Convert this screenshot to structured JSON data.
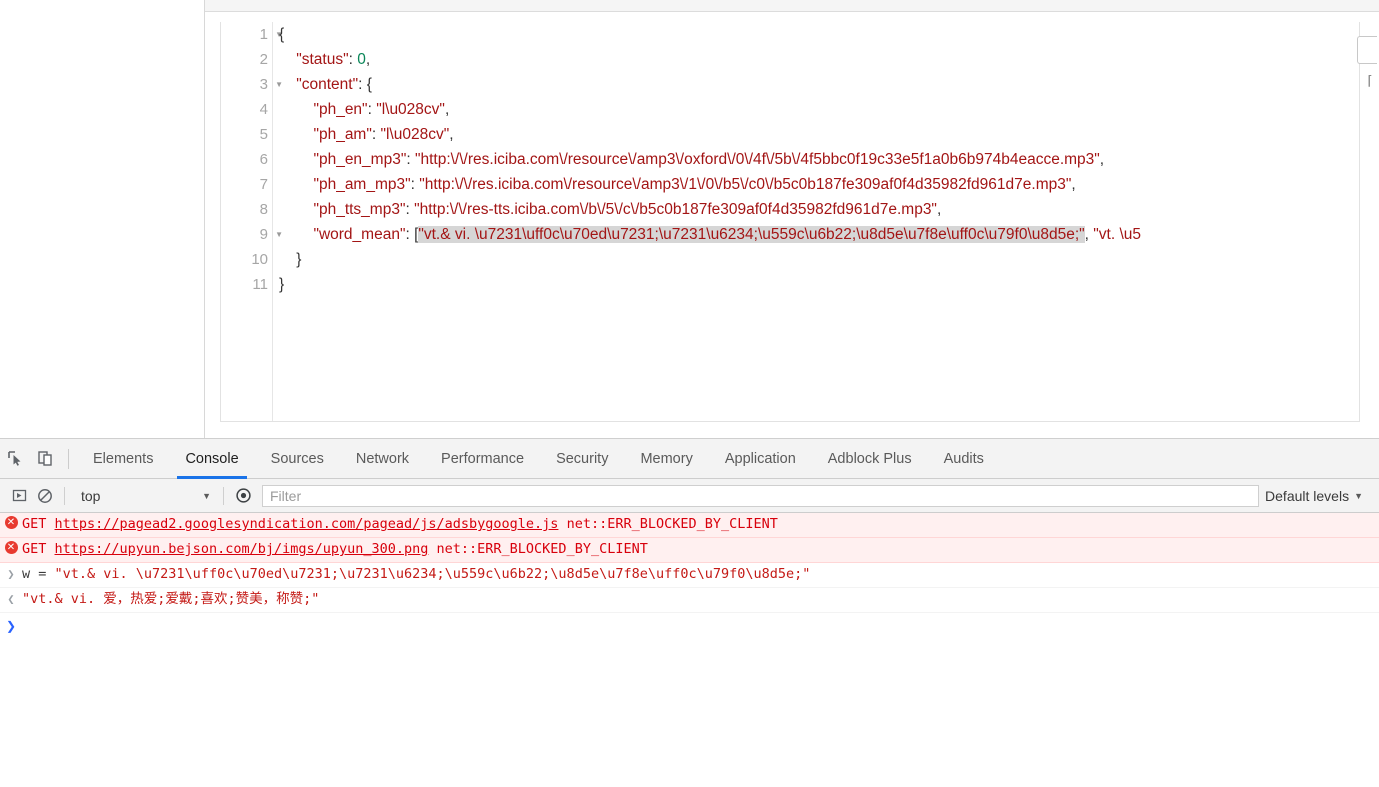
{
  "json_viewer": {
    "line_numbers": [
      "1",
      "2",
      "3",
      "4",
      "5",
      "6",
      "7",
      "8",
      "9",
      "10",
      "11"
    ],
    "fold_lines": [
      1,
      3,
      9
    ],
    "lines": [
      {
        "indent": 0,
        "segments": [
          {
            "t": "{",
            "c": "p"
          }
        ]
      },
      {
        "indent": 1,
        "segments": [
          {
            "t": "\"status\"",
            "c": "k"
          },
          {
            "t": ": ",
            "c": "p"
          },
          {
            "t": "0",
            "c": "n"
          },
          {
            "t": ",",
            "c": "p"
          }
        ]
      },
      {
        "indent": 1,
        "segments": [
          {
            "t": "\"content\"",
            "c": "k"
          },
          {
            "t": ": {",
            "c": "p"
          }
        ]
      },
      {
        "indent": 2,
        "segments": [
          {
            "t": "\"ph_en\"",
            "c": "k"
          },
          {
            "t": ": ",
            "c": "p"
          },
          {
            "t": "\"l\\u028cv\"",
            "c": "k"
          },
          {
            "t": ",",
            "c": "p"
          }
        ]
      },
      {
        "indent": 2,
        "segments": [
          {
            "t": "\"ph_am\"",
            "c": "k"
          },
          {
            "t": ": ",
            "c": "p"
          },
          {
            "t": "\"l\\u028cv\"",
            "c": "k"
          },
          {
            "t": ",",
            "c": "p"
          }
        ]
      },
      {
        "indent": 2,
        "segments": [
          {
            "t": "\"ph_en_mp3\"",
            "c": "k"
          },
          {
            "t": ": ",
            "c": "p"
          },
          {
            "t": "\"http:\\/\\/res.iciba.com\\/resource\\/amp3\\/oxford\\/0\\/4f\\/5b\\/4f5bbc0f19c33e5f1a0b6b974b4eacce.mp3\"",
            "c": "k"
          },
          {
            "t": ",",
            "c": "p"
          }
        ]
      },
      {
        "indent": 2,
        "segments": [
          {
            "t": "\"ph_am_mp3\"",
            "c": "k"
          },
          {
            "t": ": ",
            "c": "p"
          },
          {
            "t": "\"http:\\/\\/res.iciba.com\\/resource\\/amp3\\/1\\/0\\/b5\\/c0\\/b5c0b187fe309af0f4d35982fd961d7e.mp3\"",
            "c": "k"
          },
          {
            "t": ",",
            "c": "p"
          }
        ]
      },
      {
        "indent": 2,
        "segments": [
          {
            "t": "\"ph_tts_mp3\"",
            "c": "k"
          },
          {
            "t": ": ",
            "c": "p"
          },
          {
            "t": "\"http:\\/\\/res-tts.iciba.com\\/b\\/5\\/c\\/b5c0b187fe309af0f4d35982fd961d7e.mp3\"",
            "c": "k"
          },
          {
            "t": ",",
            "c": "p"
          }
        ]
      },
      {
        "indent": 2,
        "segments": [
          {
            "t": "\"word_mean\"",
            "c": "k"
          },
          {
            "t": ": [",
            "c": "p"
          },
          {
            "t": "\"vt.& vi. \\u7231\\uff0c\\u70ed\\u7231;\\u7231\\u6234;\\u559c\\u6b22;\\u8d5e\\u7f8e\\uff0c\\u79f0\\u8d5e;\"",
            "c": "k sel"
          },
          {
            "t": ", ",
            "c": "p"
          },
          {
            "t": "\"vt. \\u5",
            "c": "k"
          }
        ]
      },
      {
        "indent": 1,
        "segments": [
          {
            "t": "}",
            "c": "p"
          }
        ]
      },
      {
        "indent": 0,
        "segments": [
          {
            "t": "}",
            "c": "p"
          }
        ]
      }
    ]
  },
  "devtools": {
    "icons": {
      "inspect": "inspect-element-icon",
      "device": "device-toolbar-icon",
      "execute": "execution-context-icon",
      "clear": "clear-console-icon",
      "eye": "console-sidebar-eye-icon"
    },
    "tabs": [
      {
        "label": "Elements",
        "active": false
      },
      {
        "label": "Console",
        "active": true
      },
      {
        "label": "Sources",
        "active": false
      },
      {
        "label": "Network",
        "active": false
      },
      {
        "label": "Performance",
        "active": false
      },
      {
        "label": "Security",
        "active": false
      },
      {
        "label": "Memory",
        "active": false
      },
      {
        "label": "Application",
        "active": false
      },
      {
        "label": "Adblock Plus",
        "active": false
      },
      {
        "label": "Audits",
        "active": false
      }
    ],
    "filterbar": {
      "context": "top",
      "filter_placeholder": "Filter",
      "filter_value": "",
      "levels": "Default levels"
    },
    "console_rows": [
      {
        "kind": "error",
        "method": "GET",
        "url": "https://pagead2.googlesyndication.com/pagead/js/adsbygoogle.js",
        "neterr": "net::ERR_BLOCKED_BY_CLIENT"
      },
      {
        "kind": "error",
        "method": "GET",
        "url": "https://upyun.bejson.com/bj/imgs/upyun_300.png",
        "neterr": "net::ERR_BLOCKED_BY_CLIENT"
      },
      {
        "kind": "input",
        "expr": "w = ",
        "value": "\"vt.& vi. \\u7231\\uff0c\\u70ed\\u7231;\\u7231\\u6234;\\u559c\\u6b22;\\u8d5e\\u7f8e\\uff0c\\u79f0\\u8d5e;\""
      },
      {
        "kind": "output",
        "expr": "",
        "value": "\"vt.& vi. 爱，热爱;爱戴;喜欢;赞美，称赞;\""
      }
    ]
  },
  "colors": {
    "accent": "#1a73e8",
    "error_text": "#d8000c",
    "error_bg": "#fff0f0",
    "json_key": "#a31515",
    "json_number": "#098658",
    "selection": "#d6d6d6"
  }
}
